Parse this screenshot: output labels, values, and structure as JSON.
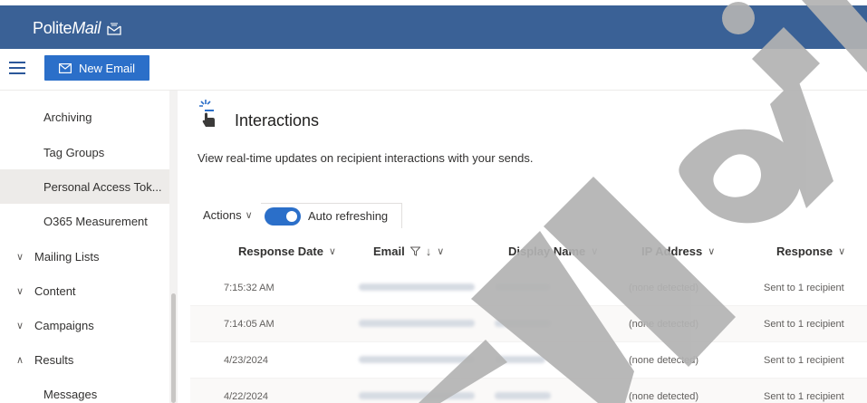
{
  "app": {
    "logo_polite": "Polite",
    "logo_mail": "Mail"
  },
  "toolbar": {
    "new_email_label": "New Email"
  },
  "sidebar": {
    "items": [
      {
        "label": "Archiving",
        "kind": "sub"
      },
      {
        "label": "Tag Groups",
        "kind": "sub"
      },
      {
        "label": "Personal Access Tok...",
        "kind": "sub",
        "selected": true
      },
      {
        "label": "O365 Measurement",
        "kind": "sub"
      },
      {
        "label": "Mailing Lists",
        "kind": "group",
        "chevron": "chevron-down-icon"
      },
      {
        "label": "Content",
        "kind": "group",
        "chevron": "chevron-down-icon"
      },
      {
        "label": "Campaigns",
        "kind": "group",
        "chevron": "chevron-down-icon"
      },
      {
        "label": "Results",
        "kind": "group",
        "chevron": "chevron-up-icon"
      },
      {
        "label": "Messages",
        "kind": "sub"
      }
    ]
  },
  "main": {
    "title": "Interactions",
    "description": "View real-time updates on recipient interactions with your sends.",
    "actions_label": "Actions",
    "auto_refresh_label": "Auto refreshing",
    "auto_refresh_on": true,
    "columns": [
      "Response Date",
      "Email",
      "Display Name",
      "IP Address",
      "Response"
    ],
    "rows": [
      {
        "date": "7:15:32 AM",
        "ip": "(none detected)",
        "response": "Sent to 1 recipient"
      },
      {
        "date": "7:14:05 AM",
        "ip": "(none detected)",
        "response": "Sent to 1 recipient"
      },
      {
        "date": "4/23/2024",
        "ip": "(none detected)",
        "response": "Sent to 1 recipient"
      },
      {
        "date": "4/22/2024",
        "ip": "(none detected)",
        "response": "Sent to 1 recipient"
      }
    ]
  },
  "colors": {
    "topbar": "#3a6196",
    "accent": "#2b6fc9"
  }
}
